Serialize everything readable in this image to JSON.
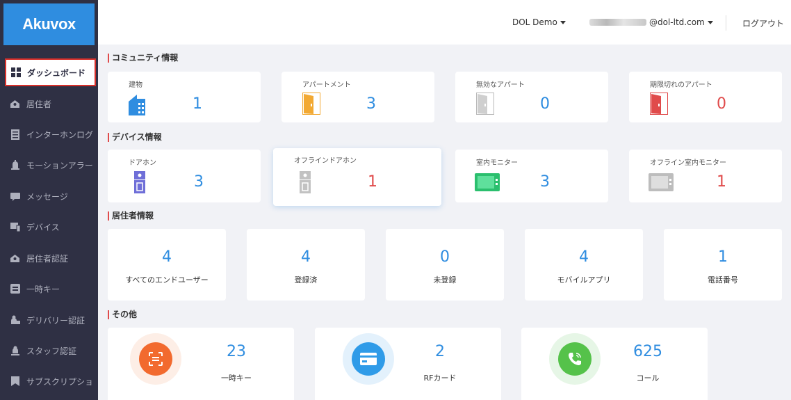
{
  "logo": "Akuvox",
  "header": {
    "site": "DOL Demo",
    "account_suffix": "@dol-ltd.com",
    "logout": "ログアウト"
  },
  "sidebar": {
    "items": [
      {
        "label": "ダッシュボード",
        "icon": "dashboard-icon"
      },
      {
        "label": "居住者",
        "icon": "residents-icon"
      },
      {
        "label": "インターホンログ",
        "icon": "log-icon"
      },
      {
        "label": "モーションアラー",
        "icon": "motion-alarm-icon"
      },
      {
        "label": "メッセージ",
        "icon": "message-icon"
      },
      {
        "label": "デバイス",
        "icon": "device-icon"
      },
      {
        "label": "居住者認証",
        "icon": "resident-auth-icon"
      },
      {
        "label": "一時キー",
        "icon": "temp-key-icon"
      },
      {
        "label": "デリバリー認証",
        "icon": "delivery-auth-icon"
      },
      {
        "label": "スタッフ認証",
        "icon": "staff-auth-icon"
      },
      {
        "label": "サブスクリプショ",
        "icon": "subscription-icon"
      }
    ]
  },
  "community": {
    "title": "コミュニティ情報",
    "cards": [
      {
        "label": "建物",
        "value": "1",
        "icon": "building-icon"
      },
      {
        "label": "アパートメント",
        "value": "3",
        "icon": "door-icon"
      },
      {
        "label": "無効なアパート",
        "value": "0",
        "icon": "door-disabled-icon"
      },
      {
        "label": "期限切れのアパート",
        "value": "0",
        "icon": "door-expired-icon"
      }
    ]
  },
  "device": {
    "title": "デバイス情報",
    "cards": [
      {
        "label": "ドアホン",
        "value": "3",
        "icon": "doorphone-icon"
      },
      {
        "label": "オフラインドアホン",
        "value": "1",
        "icon": "doorphone-offline-icon"
      },
      {
        "label": "室内モニター",
        "value": "3",
        "icon": "indoor-monitor-icon"
      },
      {
        "label": "オフライン室内モニター",
        "value": "1",
        "icon": "indoor-monitor-offline-icon"
      }
    ]
  },
  "resident": {
    "title": "居住者情報",
    "cards": [
      {
        "value": "4",
        "label": "すべてのエンドユーザー"
      },
      {
        "value": "4",
        "label": "登録済"
      },
      {
        "value": "0",
        "label": "未登録"
      },
      {
        "value": "4",
        "label": "モバイルアプリ"
      },
      {
        "value": "1",
        "label": "電話番号"
      }
    ]
  },
  "other": {
    "title": "その他",
    "cards": [
      {
        "value": "23",
        "label": "一時キー",
        "icon": "temp-key-icon"
      },
      {
        "value": "2",
        "label": "RFカード",
        "icon": "rf-card-icon"
      },
      {
        "value": "625",
        "label": "コール",
        "icon": "call-icon"
      }
    ]
  },
  "colors": {
    "accent": "#2f8de0",
    "alert": "#e04b4b",
    "sidebar": "#2f3044"
  }
}
